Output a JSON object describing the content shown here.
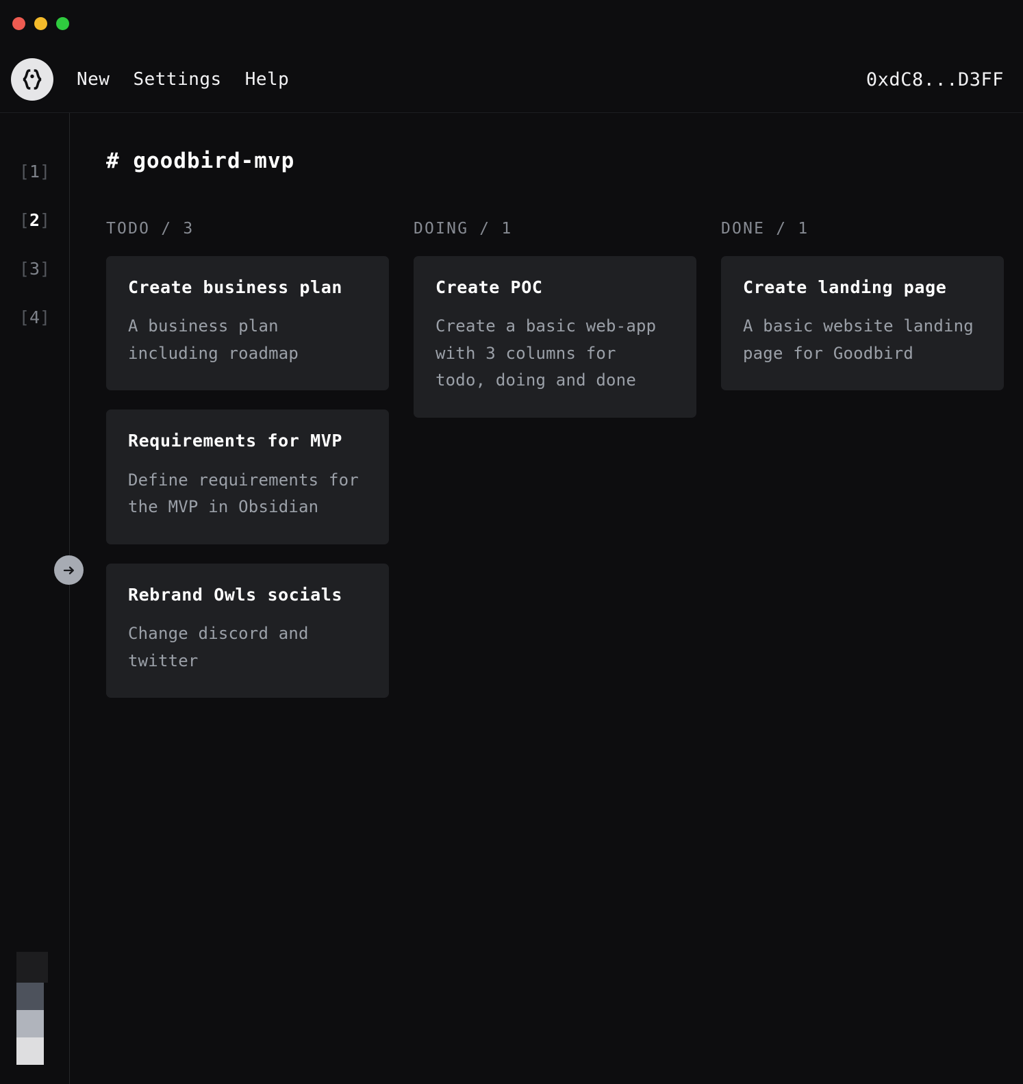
{
  "window": {
    "traffic_lights": [
      {
        "name": "close",
        "color": "#ee5b51"
      },
      {
        "name": "minimize",
        "color": "#f4bb2b"
      },
      {
        "name": "maximize",
        "color": "#2fcb3f"
      }
    ]
  },
  "topnav": {
    "logo_icon": "braces-dot-logo-icon",
    "links": [
      {
        "label": "New"
      },
      {
        "label": "Settings"
      },
      {
        "label": "Help"
      }
    ],
    "wallet_address": "0xdC8...D3FF"
  },
  "rail": {
    "pages": [
      {
        "label": "[1]",
        "open": "[",
        "num": "1",
        "close": "]",
        "active": false
      },
      {
        "label": "[2]",
        "open": "[",
        "num": "2",
        "close": "]",
        "active": true
      },
      {
        "label": "[3]",
        "open": "[",
        "num": "3",
        "close": "]",
        "active": false
      },
      {
        "label": "[4]",
        "open": "[",
        "num": "4",
        "close": "]",
        "active": false
      }
    ],
    "toggle_icon": "arrow-right-icon",
    "swatches": [
      {
        "name": "swatch-dark",
        "color": "#1d1d1f"
      },
      {
        "name": "swatch-slate",
        "color": "#4d525c"
      },
      {
        "name": "swatch-silver",
        "color": "#b0b4bc"
      },
      {
        "name": "swatch-white",
        "color": "#dedee0"
      }
    ]
  },
  "board": {
    "title": "# goodbird-mvp",
    "columns": [
      {
        "header": "TODO / 3",
        "name": "todo",
        "count": 3,
        "cards": [
          {
            "title": "Create business plan",
            "desc": "A business plan including roadmap"
          },
          {
            "title": "Requirements for MVP",
            "desc": "Define requirements for the MVP in Obsidian"
          },
          {
            "title": "Rebrand Owls socials",
            "desc": "Change discord and twitter"
          }
        ]
      },
      {
        "header": "DOING / 1",
        "name": "doing",
        "count": 1,
        "cards": [
          {
            "title": "Create POC",
            "desc": "Create a basic web-app with 3 columns for todo, doing and done"
          }
        ]
      },
      {
        "header": "DONE / 1",
        "name": "done",
        "count": 1,
        "cards": [
          {
            "title": "Create landing page",
            "desc": "A basic website landing page for Goodbird"
          }
        ]
      }
    ]
  },
  "colors": {
    "page_bg": "#0d0d0f",
    "card_bg": "#1f2023",
    "text_primary": "#ffffff",
    "text_muted": "#9ba0a8",
    "text_dim": "#53565c",
    "divider": "#26272a",
    "accent": "#a7abb3"
  }
}
